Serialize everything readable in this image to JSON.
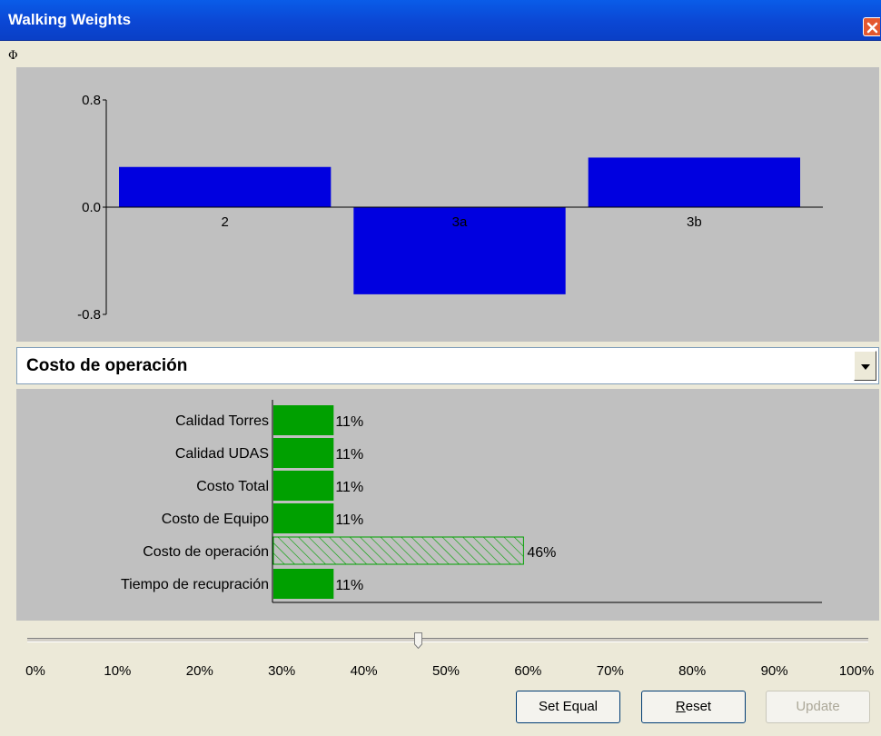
{
  "window": {
    "title": "Walking Weights"
  },
  "toolbar": {
    "phi_label": "Φ"
  },
  "chart_data": {
    "type": "bar",
    "categories": [
      "2",
      "3a",
      "3b"
    ],
    "values": [
      0.3,
      -0.65,
      0.37
    ],
    "ylim": [
      -0.8,
      0.8
    ],
    "yticks": [
      "0.8",
      "0.0",
      "-0.8"
    ],
    "bar_color": "#0000e0"
  },
  "criterion_select": {
    "value": "Costo de operación"
  },
  "weights": {
    "items": [
      {
        "label": "Calidad Torres",
        "percent_text": "11%",
        "value": 11,
        "selected": false
      },
      {
        "label": "Calidad UDAS",
        "percent_text": "11%",
        "value": 11,
        "selected": false
      },
      {
        "label": "Costo Total",
        "percent_text": "11%",
        "value": 11,
        "selected": false
      },
      {
        "label": "Costo de Equipo",
        "percent_text": "11%",
        "value": 11,
        "selected": false
      },
      {
        "label": "Costo de operación",
        "percent_text": "46%",
        "value": 46,
        "selected": true
      },
      {
        "label": "Tiempo de recupración",
        "percent_text": "11%",
        "value": 11,
        "selected": false
      }
    ],
    "bar_color": "#00a000"
  },
  "slider": {
    "value_percent": 46,
    "ticks": [
      "0%",
      "10%",
      "20%",
      "30%",
      "40%",
      "50%",
      "60%",
      "70%",
      "80%",
      "90%",
      "100%"
    ]
  },
  "buttons": {
    "set_equal": "Set Equal",
    "reset": "Reset",
    "update": "Update"
  },
  "colors": {
    "titlebar": "#0a4fd8",
    "panel_bg": "#c0c0c0",
    "window_bg": "#ece9d8"
  }
}
